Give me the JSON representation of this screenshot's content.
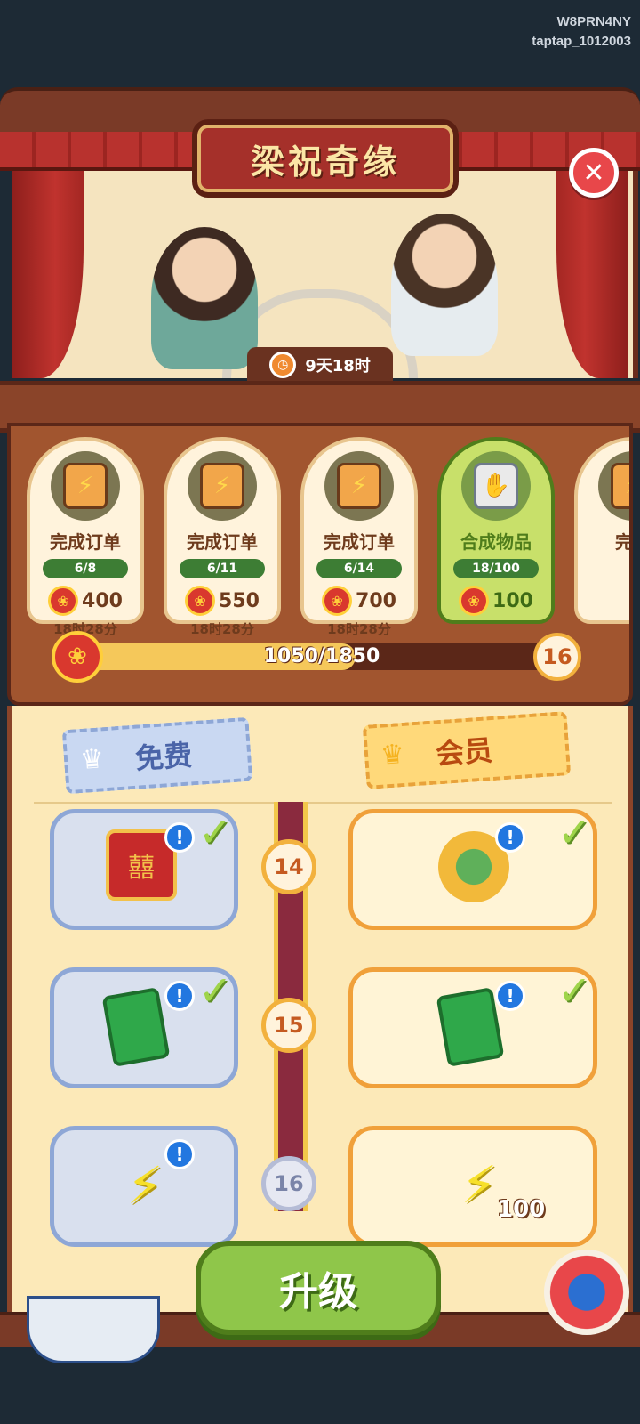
{
  "watermark": {
    "line1": "W8PRN4NY",
    "line2": "taptap_1012003"
  },
  "event": {
    "title": "梁祝奇缘",
    "timer": "9天18时"
  },
  "tasks": [
    {
      "name": "完成订单",
      "progress": "6/8",
      "reward": "400",
      "time": "18时28分",
      "active": false
    },
    {
      "name": "完成订单",
      "progress": "6/11",
      "reward": "550",
      "time": "18时28分",
      "active": false
    },
    {
      "name": "完成订单",
      "progress": "6/14",
      "reward": "700",
      "time": "18时28分",
      "active": false
    },
    {
      "name": "合成物品",
      "progress": "18/100",
      "reward": "100",
      "time": "",
      "active": true
    },
    {
      "name": "完成",
      "progress": "",
      "reward": "",
      "time": "",
      "active": false
    }
  ],
  "progress": {
    "text": "1050/1850",
    "fraction": 0.5676,
    "level": "16"
  },
  "tabs": {
    "free": "免费",
    "vip": "会员"
  },
  "levels": [
    {
      "level": "14",
      "free_claimed": true,
      "vip_claimed": true,
      "locked": false
    },
    {
      "level": "15",
      "free_claimed": true,
      "vip_claimed": true,
      "locked": false
    },
    {
      "level": "16",
      "free_claimed": false,
      "vip_claimed": false,
      "locked": true,
      "vip_qty": "100"
    }
  ],
  "upgrade_button": "升级",
  "colors": {
    "accent_green": "#8fc64a",
    "wood": "#a1552f",
    "vip_orange": "#f0a03a",
    "free_blue": "#8ea7d6"
  }
}
